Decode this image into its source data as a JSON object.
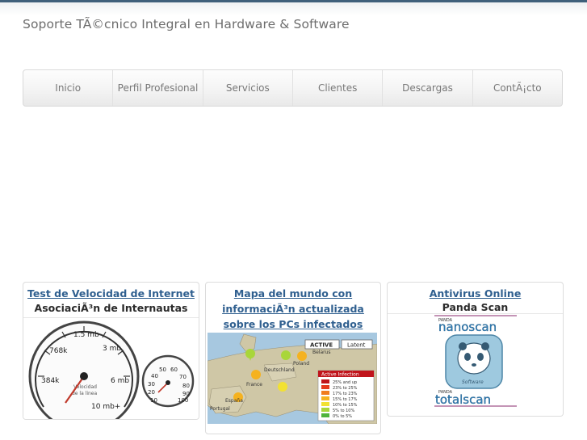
{
  "site": {
    "title": "Soporte TÃ©cnico Integral en Hardware & Software"
  },
  "nav": {
    "items": [
      {
        "label": "Inicio"
      },
      {
        "label": "Perfil Profesional"
      },
      {
        "label": "Servicios"
      },
      {
        "label": "Clientes"
      },
      {
        "label": "Descargas"
      },
      {
        "label": "ContÃ¡cto"
      }
    ]
  },
  "widgets": {
    "speed": {
      "link": "Test de Velocidad de Internet",
      "subtitle": "AsociaciÃ³n de Internautas",
      "gauge_labels": [
        "1.5 mb",
        "3 mb",
        "768k",
        "384k",
        "6 mb",
        "10 mb+"
      ],
      "gauge_caption": [
        "Velocidad",
        "de la linea"
      ],
      "small_gauge_labels": [
        "40",
        "50",
        "60",
        "70",
        "30",
        "80",
        "20",
        "90",
        "10",
        "100"
      ]
    },
    "map": {
      "link": "Mapa del mundo con informaciÃ³n actualizada sobre los PCs infectados",
      "buttons": [
        "ACTIVE",
        "Latent"
      ],
      "legend_title": "Active Infection",
      "legend": [
        "25% and up",
        "23% to 25%",
        "17% to 23%",
        "15% to 17%",
        "10% to 15%",
        "5% to 10%",
        "0% to 5%"
      ],
      "legend_colors": [
        "#c0141b",
        "#e5391d",
        "#f07d1e",
        "#f5b21f",
        "#f2e132",
        "#a9d63a",
        "#4fb43b"
      ],
      "places": [
        "Deutschland",
        "France",
        "España",
        "Portugal",
        "Poland",
        "Belarus"
      ]
    },
    "antivirus": {
      "link": "Antivirus Online",
      "subtitle": "Panda Scan",
      "top_word": "nanoscan",
      "bottom_word": "totalscan",
      "brand_small": "PANDA",
      "brand_software": "Software"
    }
  }
}
